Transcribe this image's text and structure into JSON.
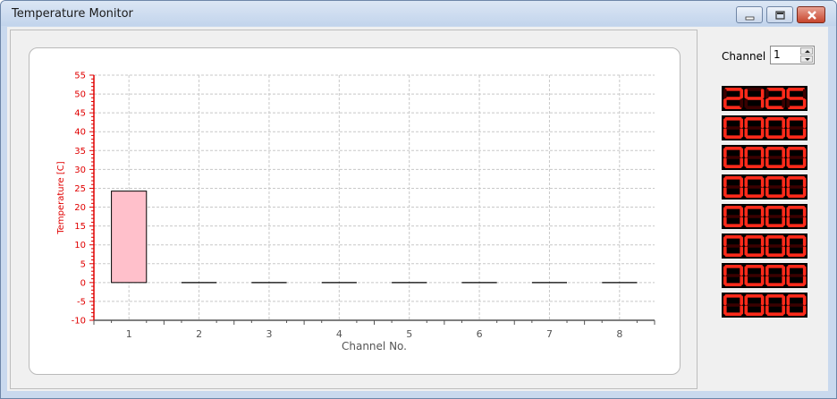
{
  "window": {
    "title": "Temperature Monitor"
  },
  "channel": {
    "label": "Channel",
    "value": "1"
  },
  "chart_data": {
    "type": "bar",
    "categories": [
      "1",
      "2",
      "3",
      "4",
      "5",
      "6",
      "7",
      "8"
    ],
    "values": [
      24.25,
      0,
      0,
      0,
      0,
      0,
      0,
      0
    ],
    "xlabel": "Channel No.",
    "ylabel": "Temperature [C]",
    "ylim": [
      -10,
      55
    ],
    "yticks": [
      "-10",
      "-5",
      "0",
      "5",
      "10",
      "15",
      "20",
      "25",
      "30",
      "35",
      "40",
      "45",
      "50",
      "55"
    ],
    "grid": true,
    "colors": {
      "bar": "#ffc0cb",
      "axis": "#e00000",
      "grid": "#c8c8c8"
    }
  },
  "displays": [
    "24.25",
    "00.00",
    "00.00",
    "00.00",
    "00.00",
    "00.00",
    "00.00",
    "00.00"
  ],
  "colors": {
    "led_on": "#ff2a1a",
    "led_off": "#3a0000"
  }
}
